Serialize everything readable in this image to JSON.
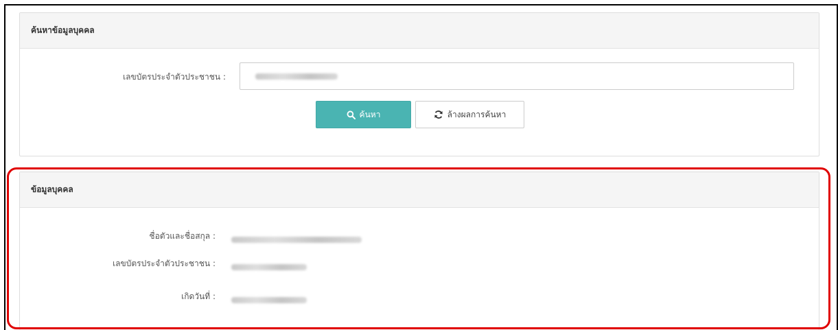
{
  "search_panel": {
    "title": "ค้นหาข้อมูลบุคคล",
    "id_label": "เลขบัตรประจำตัวประชาชน :",
    "search_button": "ค้นหา",
    "clear_button": "ล้างผลการค้นหา"
  },
  "person_panel": {
    "title": "ข้อมูลบุคคล",
    "rows": [
      {
        "label": "ชื่อตัวและชื่อสกุล :"
      },
      {
        "label": "เลขบัตรประจำตัวประชาชน :"
      },
      {
        "label": "เกิดวันที่ :"
      }
    ]
  },
  "colors": {
    "primary_button": "#4ab4b2",
    "highlight": "#e00000",
    "panel_header": "#f5f5f5"
  },
  "icons": {
    "search_button": "search-icon",
    "clear_button": "refresh-icon"
  }
}
